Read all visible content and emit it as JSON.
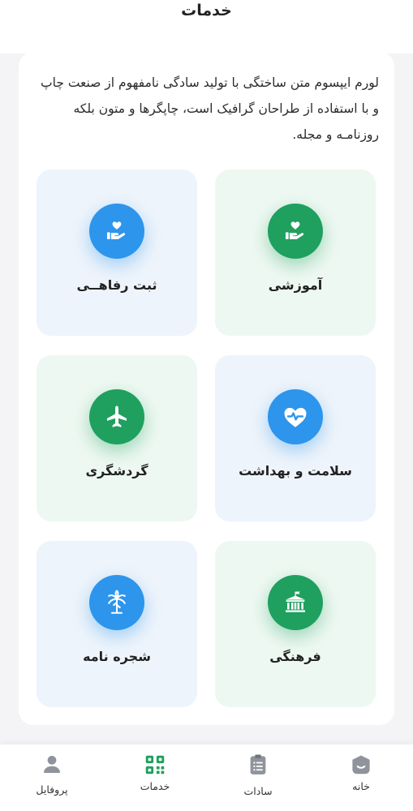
{
  "header": {
    "title": "خدمات"
  },
  "intro": {
    "text": "لورم ایپسوم متن ساختگی با تولید سادگی نامفهوم از صنعت چاپ و با استفاده از طراحان گرافیک است، چاپگرها و متون بلکه روزنامـه و مجله."
  },
  "services": [
    {
      "label": "آموزشی",
      "icon": "hand-heart-icon",
      "color": "#1fa05e"
    },
    {
      "label": "ثبت رفاهــی",
      "icon": "hand-heart-icon",
      "color": "#2d95ec"
    },
    {
      "label": "سلامت و بهداشت",
      "icon": "heart-pulse-icon",
      "color": "#2d95ec"
    },
    {
      "label": "گردشگری",
      "icon": "airplane-icon",
      "color": "#1fa05e"
    },
    {
      "label": "فرهنگی",
      "icon": "museum-icon",
      "color": "#1fa05e"
    },
    {
      "label": "شجره نامه",
      "icon": "palm-tree-icon",
      "color": "#2d95ec"
    }
  ],
  "nav": {
    "home": "خانه",
    "sadat": "سادات",
    "services": "خدمات",
    "profile": "پروفایل"
  },
  "colors": {
    "accent_green": "#1fa05e",
    "accent_blue": "#2d95ec"
  }
}
